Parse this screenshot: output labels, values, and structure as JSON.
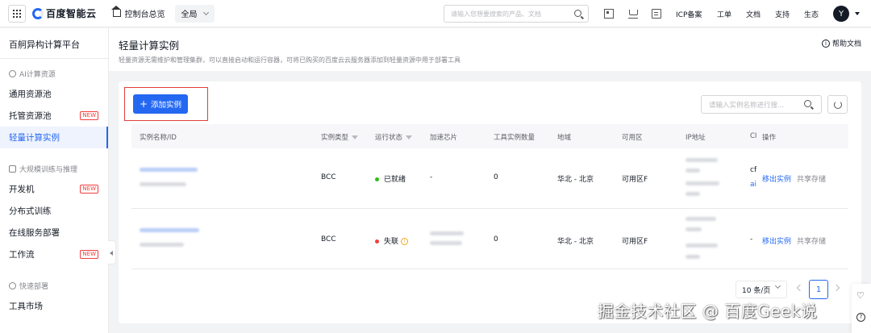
{
  "topbar": {
    "brand": "百度智能云",
    "console_home": "控制台总览",
    "scope": "全局",
    "search_placeholder": "请输入您想要搜索的产品、文档",
    "links": [
      "ICP备案",
      "工单",
      "文档",
      "支持",
      "生态"
    ],
    "avatar_letter": "Y"
  },
  "sidebar": {
    "platform_title": "百舸异构计算平台",
    "sections": [
      {
        "label": "AI计算资源",
        "items": [
          {
            "label": "通用资源池",
            "badge": ""
          },
          {
            "label": "托管资源池",
            "badge": "NEW"
          },
          {
            "label": "轻量计算实例",
            "badge": "",
            "active": true
          }
        ]
      },
      {
        "label": "大规模训练与推理",
        "items": [
          {
            "label": "开发机",
            "badge": "NEW"
          },
          {
            "label": "分布式训练",
            "badge": ""
          },
          {
            "label": "在线服务部署",
            "badge": ""
          },
          {
            "label": "工作流",
            "badge": "NEW"
          }
        ]
      },
      {
        "label": "快速部署",
        "items": [
          {
            "label": "工具市场",
            "badge": ""
          }
        ]
      }
    ]
  },
  "page": {
    "title": "轻量计算实例",
    "description": "轻量资源无需维护和管理集群，可以直接启动和运行容器，可将已购买的百度云云服务器添加到轻量资源中用于部署工具",
    "help_doc": "帮助文档"
  },
  "toolbar": {
    "add_label": "添加实例",
    "search_placeholder": "请输入实例名称进行搜..."
  },
  "table": {
    "columns": [
      "实例名称/ID",
      "实例类型",
      "运行状态",
      "加速芯片",
      "工具实例数量",
      "地域",
      "可用区",
      "IP地址",
      "CI",
      "操作"
    ],
    "rows": [
      {
        "type": "BCC",
        "status": "已就绪",
        "status_color": "#30bf13",
        "chip": "-",
        "tool_count": "0",
        "region": "华北 - 北京",
        "zone": "可用区F",
        "cut": "cf",
        "cut2": "ai",
        "actions": [
          "移出实例",
          "共享存储"
        ]
      },
      {
        "type": "BCC",
        "status": "失联",
        "status_color": "#f33e3e",
        "chip": "",
        "tool_count": "0",
        "region": "华北 - 北京",
        "zone": "可用区F",
        "cut": "-",
        "cut2": "",
        "actions": [
          "移出实例",
          "共享存储"
        ]
      }
    ]
  },
  "pagination": {
    "page_size": "10 条/页",
    "current_page": "1"
  },
  "watermark": "掘金技术社区 @ 百度Geek说",
  "colors": {
    "accent": "#2468f2",
    "danger": "#f33e3e",
    "ok": "#30bf13"
  }
}
